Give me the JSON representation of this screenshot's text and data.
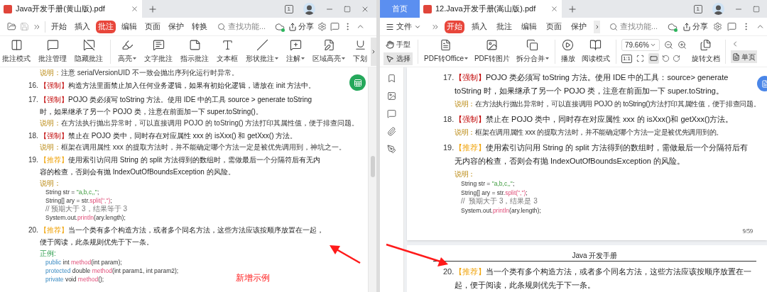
{
  "left_window": {
    "tab": {
      "title": "Java开发手册(黄山版).pdf",
      "selected": true
    },
    "page_count_badge": "1",
    "ribbon_tabs": [
      {
        "label": "开始",
        "selected": false
      },
      {
        "label": "插入",
        "selected": false
      },
      {
        "label": "批注",
        "selected": true
      },
      {
        "label": "编辑",
        "selected": false
      },
      {
        "label": "页面",
        "selected": false
      },
      {
        "label": "保护",
        "selected": false
      },
      {
        "label": "转换",
        "selected": false
      }
    ],
    "search": {
      "placeholder": "查找功能..."
    },
    "share": "分享",
    "tools": [
      {
        "label": "批注模式",
        "dropdown": false
      },
      {
        "label": "批注管理",
        "dropdown": false
      },
      {
        "label": "隐藏批注",
        "dropdown": false
      },
      {
        "label": "高亮",
        "dropdown": true
      },
      {
        "label": "文字批注",
        "dropdown": false
      },
      {
        "label": "指示批注",
        "dropdown": false
      },
      {
        "label": "文本框",
        "dropdown": false
      },
      {
        "label": "形状批注",
        "dropdown": true
      },
      {
        "label": "注解",
        "dropdown": true
      },
      {
        "label": "区域高亮",
        "dropdown": true
      },
      {
        "label": "下划",
        "dropdown": false
      }
    ],
    "document": [
      {
        "kind": "note",
        "label": "说明：",
        "text": "注意 serialVersionUID 不一致会抛出序列化运行时异常。"
      },
      {
        "kind": "mandatory",
        "number": "16.",
        "tag": "【强制】",
        "text": "构造方法里面禁止加入任何业务逻辑，如果有初始化逻辑，请放在 init 方法中。"
      },
      {
        "kind": "mandatory",
        "number": "17.",
        "tag": "【强制】",
        "text": "POJO 类必须写 toString 方法。使用 IDE 中的工具 source > generate toString 时，如果继承了另一个 POJO 类，注意在前面加一下 super.toString()。"
      },
      {
        "kind": "note",
        "label": "说明：",
        "text": "在方法执行抛出异常时，可以直接调用 POJO 的 toString() 方法打印其属性值，便于排查问题。"
      },
      {
        "kind": "mandatory",
        "number": "18.",
        "tag": "【强制】",
        "text": "禁止在 POJO 类中，同时存在对应属性 xxx 的 isXxx() 和 getXxx() 方法。"
      },
      {
        "kind": "note",
        "label": "说明：",
        "text": "框架在调用属性 xxx 的提取方法时，并不能确定哪个方法一定是被优先调用到，神坑之一。"
      },
      {
        "kind": "recommended",
        "number": "19.",
        "tag": "【推荐】",
        "text": "使用索引访问用 String 的 split 方法得到的数组时，需做最后一个分隔符后有无内容的检查，否则会有抛 IndexOutOfBoundsException 的风险。"
      },
      {
        "kind": "note",
        "label": "说明："
      },
      {
        "kind": "code",
        "lines": [
          [
            {
              "t": "String str = ",
              "kind": "plain"
            },
            {
              "t": "\"a,b,c,,\"",
              "kind": "string"
            },
            {
              "t": ";",
              "kind": "plain"
            }
          ],
          [
            {
              "t": "String[] ary = str.",
              "kind": "plain"
            },
            {
              "t": "split(\",\")",
              "kind": "method"
            },
            {
              "t": ";",
              "kind": "plain"
            }
          ],
          [
            {
              "t": "// 预期大于 3，结果等于 3",
              "kind": "comment"
            }
          ],
          [
            {
              "t": "System.out.",
              "kind": "plain"
            },
            {
              "t": "println",
              "kind": "method"
            },
            {
              "t": "(ary.length);",
              "kind": "plain"
            }
          ]
        ]
      },
      {
        "kind": "recommended",
        "number": "20.",
        "tag": "【推荐】",
        "text": "当一个类有多个构造方法，或者多个同名方法，这些方法应该按顺序放置在一起，便于阅读，此条规则优先于下一条。"
      },
      {
        "kind": "example",
        "label": "正例:"
      },
      {
        "kind": "code",
        "lines": [
          [
            {
              "t": "public",
              "kind": "keyword"
            },
            {
              "t": " int ",
              "kind": "plain"
            },
            {
              "t": "method",
              "kind": "method"
            },
            {
              "t": "(int param);",
              "kind": "plain"
            }
          ],
          [
            {
              "t": "protected",
              "kind": "keyword"
            },
            {
              "t": " double ",
              "kind": "plain"
            },
            {
              "t": "method",
              "kind": "method"
            },
            {
              "t": "(int param1, int param2);",
              "kind": "plain"
            }
          ],
          [
            {
              "t": "private",
              "kind": "keyword"
            },
            {
              "t": " void ",
              "kind": "plain"
            },
            {
              "t": "method",
              "kind": "method"
            },
            {
              "t": "();",
              "kind": "plain"
            }
          ]
        ]
      }
    ],
    "annotation": "新增示例"
  },
  "right_window": {
    "home_tab": {
      "label": "首页",
      "selected": false
    },
    "tab": {
      "title": "12.Java开发手册(嵩山版).pdf",
      "selected": true
    },
    "page_count_badge": "1",
    "file_menu": "文件",
    "ribbon_tabs": [
      {
        "label": "开始",
        "selected": true
      },
      {
        "label": "插入",
        "selected": false
      },
      {
        "label": "批注",
        "selected": false
      },
      {
        "label": "编辑",
        "selected": false
      },
      {
        "label": "页面",
        "selected": false
      },
      {
        "label": "保护",
        "selected": false
      }
    ],
    "search": {
      "placeholder": "查找功能..."
    },
    "share": "分享",
    "mode_tools": [
      {
        "label": "手型",
        "selected": false
      },
      {
        "label": "选择",
        "selected": true
      }
    ],
    "tools": [
      {
        "label": "PDF转Office",
        "dropdown": true
      },
      {
        "label": "PDF转图片",
        "dropdown": false
      },
      {
        "label": "拆分合并",
        "dropdown": true
      },
      {
        "label": "播放",
        "dropdown": false
      },
      {
        "label": "阅读模式",
        "dropdown": false
      }
    ],
    "zoom": {
      "value": "79.66%"
    },
    "actual_size": "1:1",
    "fit_buttons": [
      {
        "selected": false
      },
      {
        "selected": true
      }
    ],
    "rotate_document": "旋转文档",
    "single_page": {
      "label": "单页",
      "selected": true
    },
    "page1": [
      {
        "kind": "mandatory",
        "number": "17.",
        "tag": "【强制】",
        "text": "POJO 类必须写 toString 方法。使用 IDE 中的工具：source> generate toString 时，如果继承了另一个 POJO 类，注意在前面加一下 super.toString。"
      },
      {
        "kind": "note",
        "label": "说明：",
        "text": "在方法执行抛出异常时，可以直接调用 POJO 的 toString()方法打印其属性值，便于排查问题。"
      },
      {
        "kind": "mandatory",
        "number": "18.",
        "tag": "【强制】",
        "text": "禁止在 POJO 类中，同时存在对应属性 xxx 的 isXxx()和 getXxx()方法。"
      },
      {
        "kind": "note",
        "label": "说明：",
        "text": "框架在调用属性 xxx 的提取方法时，并不能确定哪个方法一定是被优先调用到的。"
      },
      {
        "kind": "recommended",
        "number": "19.",
        "tag": "【推荐】",
        "text": "使用索引访问用 String 的 split 方法得到的数组时，需做最后一个分隔符后有无内容的检查，否则会有抛 IndexOutOfBoundsException 的风险。"
      },
      {
        "kind": "note",
        "label": "说明："
      },
      {
        "kind": "code",
        "lines": [
          [
            {
              "t": "String str = ",
              "kind": "plain"
            },
            {
              "t": "\"a,b,c,,\"",
              "kind": "string"
            },
            {
              "t": ";",
              "kind": "plain"
            }
          ],
          [
            {
              "t": "String[] ary = str.",
              "kind": "plain"
            },
            {
              "t": "split(\",\")",
              "kind": "method"
            },
            {
              "t": ";",
              "kind": "plain"
            }
          ],
          [
            {
              "t": "//  预期大于 3，结果是 3",
              "kind": "comment"
            }
          ],
          [
            {
              "t": "System.out.",
              "kind": "plain"
            },
            {
              "t": "println",
              "kind": "method"
            },
            {
              "t": "(ary.length);",
              "kind": "plain"
            }
          ]
        ]
      }
    ],
    "page_number": "9/59",
    "page_header": "Java 开发手册",
    "page2": [
      {
        "kind": "recommended",
        "number": "20.",
        "tag": "【推荐】",
        "text": "当一个类有多个构造方法，或者多个同名方法，这些方法应该按顺序放置在一起，便于阅读，此条规则优先于下一条。"
      }
    ]
  }
}
